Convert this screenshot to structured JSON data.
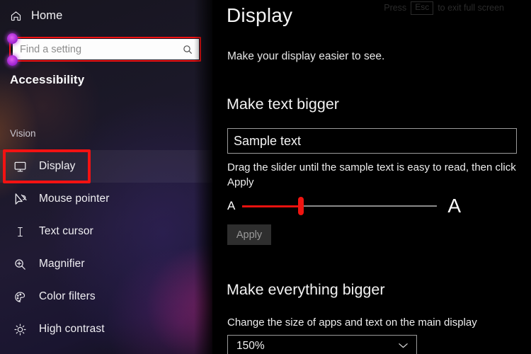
{
  "sidebar": {
    "home": {
      "label": "Home",
      "icon": "home-icon"
    },
    "search": {
      "value": "",
      "placeholder": "Find a setting",
      "icon": "search-icon"
    },
    "section_title": "Accessibility",
    "group_header": "Vision",
    "items": [
      {
        "label": "Display",
        "icon": "monitor-icon",
        "selected": true
      },
      {
        "label": "Mouse pointer",
        "icon": "mouse-pointer-icon",
        "selected": false
      },
      {
        "label": "Text cursor",
        "icon": "text-cursor-icon",
        "selected": false
      },
      {
        "label": "Magnifier",
        "icon": "magnifier-icon",
        "selected": false
      },
      {
        "label": "Color filters",
        "icon": "color-filters-icon",
        "selected": false
      },
      {
        "label": "High contrast",
        "icon": "high-contrast-icon",
        "selected": false
      }
    ]
  },
  "main": {
    "esc_hint": {
      "prefix": "Press",
      "key": "Esc",
      "suffix": "to exit full screen"
    },
    "title": "Display",
    "subtitle": "Make your display easier to see.",
    "make_text_bigger": {
      "heading": "Make text bigger",
      "sample_text": "Sample text",
      "hint": "Drag the slider until the sample text is easy to read, then click Apply",
      "slider": {
        "min_label": "A",
        "max_label": "A",
        "value_percent": 30,
        "fill_color": "#e8110f",
        "thumb_color": "#ef1410"
      },
      "apply_label": "Apply"
    },
    "make_everything_bigger": {
      "heading": "Make everything bigger",
      "description": "Change the size of apps and text on the main display",
      "scale_value": "150%",
      "chevron": "⌄"
    }
  },
  "annotations": {
    "highlight_color": "#f31212"
  }
}
